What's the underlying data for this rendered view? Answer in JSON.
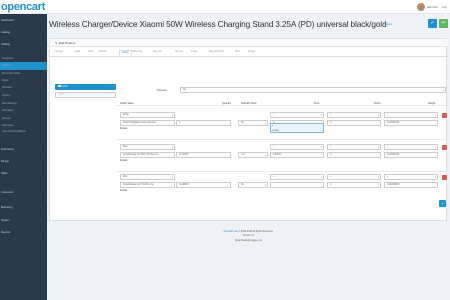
{
  "header": {
    "logo": "opencart",
    "username": "jack Chin",
    "logout": "Log"
  },
  "sidebar": {
    "items": [
      {
        "label": "Dashboard",
        "sub": false,
        "active": false
      },
      {
        "label": "Catalog",
        "sub": false,
        "active": false
      },
      {
        "label": "Catalog",
        "sub": false,
        "active": false
      },
      {
        "label": "Categories",
        "sub": true,
        "active": false
      },
      {
        "label": "Products",
        "sub": true,
        "active": true
      },
      {
        "label": "Recurring Profiles",
        "sub": true,
        "active": false
      },
      {
        "label": "Filters",
        "sub": true,
        "active": false
      },
      {
        "label": "Attributes",
        "sub": true,
        "active": false
      },
      {
        "label": "Options",
        "sub": true,
        "active": false
      },
      {
        "label": "Manufacturers",
        "sub": true,
        "active": false
      },
      {
        "label": "Downloads",
        "sub": true,
        "active": false
      },
      {
        "label": "Reviews",
        "sub": true,
        "active": false
      },
      {
        "label": "Information",
        "sub": true,
        "active": false
      },
      {
        "label": "Xiaomi Pricing Platform",
        "sub": true,
        "active": false
      },
      {
        "label": "Extensions",
        "sub": false,
        "active": false
      },
      {
        "label": "Design",
        "sub": false,
        "active": false
      },
      {
        "label": "Sales",
        "sub": false,
        "active": false
      },
      {
        "label": "Customers",
        "sub": false,
        "active": false
      },
      {
        "label": "Marketing",
        "sub": false,
        "active": false
      },
      {
        "label": "System",
        "sub": false,
        "active": false
      },
      {
        "label": "Reports",
        "sub": false,
        "active": false
      }
    ]
  },
  "page": {
    "title": "Wireless Charger/Device Xiaomi 50W Wireless Charging Stand 3.25A (PD) universal black/gold",
    "breadcrumb_home": "Home",
    "breadcrumb_current": "Products",
    "panel_title": "Edit Product"
  },
  "tabs": [
    "General",
    "Data",
    "Links",
    "Attribute",
    "Option",
    "Recurring",
    "Discount",
    "Special",
    "Image",
    "Reward Points",
    "SEO",
    "Design"
  ],
  "options": {
    "selected": "Color",
    "input_placeholder": "Option",
    "required_label": "Required",
    "required_value": "No",
    "headers": [
      "Option Value",
      "Quantity",
      "Subtract Stock",
      "Price",
      "Points",
      "Weight"
    ],
    "default_label": "Default",
    "rows": [
      {
        "value": "White",
        "sku": "Xiaomi MagSafe-Clean Wireless",
        "qty": "1",
        "subtract": "No",
        "price_prefix": "+",
        "price": "0",
        "points_prefix": "+",
        "points": "0",
        "weight_prefix": "+",
        "weight": "0.00000000"
      },
      {
        "value": "Blue",
        "sku": "Quadcharger Pro MFS PD Blue-Sl",
        "qty": "14,00000",
        "subtract": "Yes",
        "price_prefix": "+",
        "price": "0.00000",
        "points_prefix": "+",
        "points": "0",
        "weight_prefix": "+",
        "weight": "0.00000000"
      },
      {
        "value": "Red",
        "sku": "Quadcharger Air PD 2021 Lite",
        "qty": "14,00000",
        "subtract": "No",
        "price_prefix": "+",
        "price": "",
        "points_prefix": "+",
        "points": "0",
        "weight_prefix": "+",
        "weight": "0.00000000"
      }
    ],
    "price_popup": [
      "+",
      "-",
      "0.0000"
    ]
  },
  "footer": {
    "link": "Opencart.com",
    "copy": "© 2009-2022 All Rights Reserved.",
    "version": "Version 3.x",
    "extra": "Retail Retail@engage.com"
  },
  "colors": {
    "primary": "#1e91cf",
    "success": "#5cb85c",
    "danger": "#d9534f",
    "sidebar": "#2b3a4a"
  }
}
